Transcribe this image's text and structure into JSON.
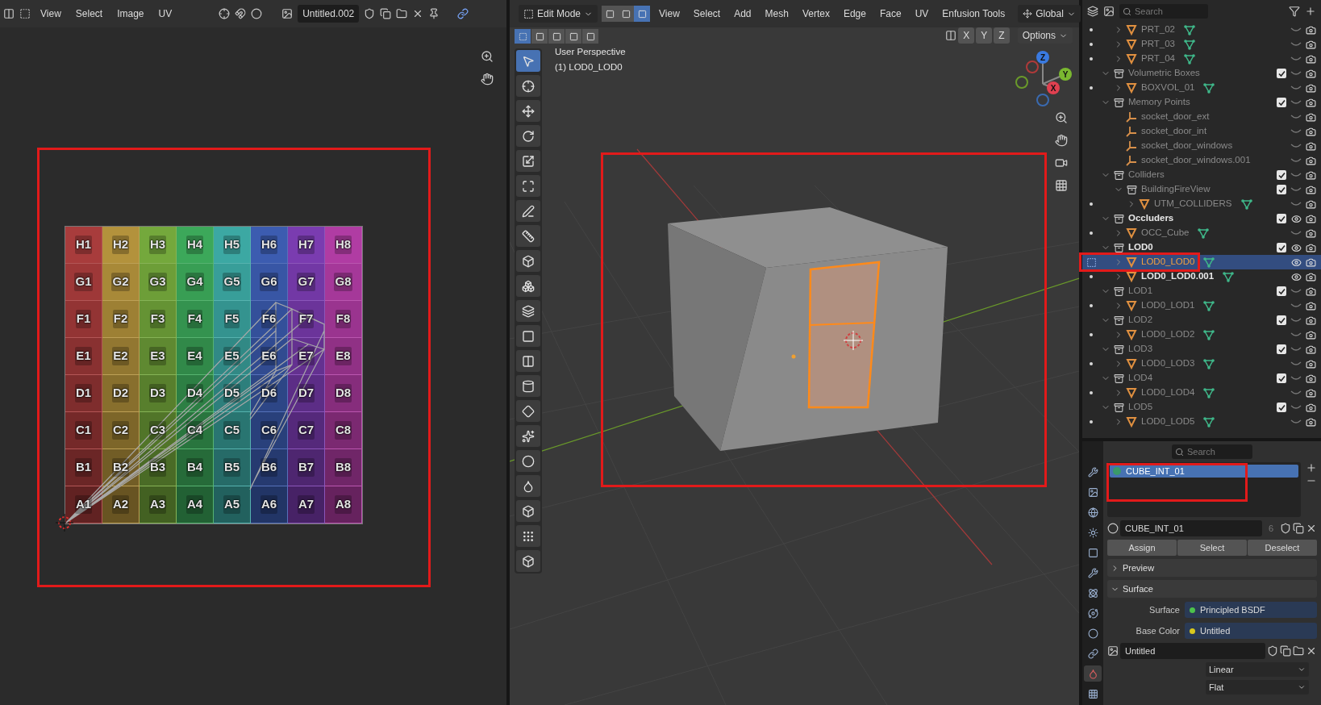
{
  "uv_editor": {
    "menus": [
      "View",
      "Select",
      "Image",
      "UV"
    ],
    "image_name": "Untitled.002",
    "grid": {
      "columns": [
        {
          "color": "#a83c3c"
        },
        {
          "color": "#b3923c"
        },
        {
          "color": "#74a83c"
        },
        {
          "color": "#3ca85a"
        },
        {
          "color": "#3ca8a3"
        },
        {
          "color": "#3c5cb0"
        },
        {
          "color": "#7a3cb0"
        },
        {
          "color": "#b03ca3"
        }
      ],
      "rows": [
        [
          "H1",
          "H2",
          "H3",
          "H4",
          "H5",
          "H6",
          "H7",
          "H8"
        ],
        [
          "G1",
          "G2",
          "G3",
          "G4",
          "G5",
          "G6",
          "G7",
          "G8"
        ],
        [
          "F1",
          "F2",
          "F3",
          "F4",
          "F5",
          "F6",
          "F7",
          "F8"
        ],
        [
          "E1",
          "E2",
          "E3",
          "E4",
          "E5",
          "E6",
          "E7",
          "E8"
        ],
        [
          "D1",
          "D2",
          "D3",
          "D4",
          "D5",
          "D6",
          "D7",
          "D8"
        ],
        [
          "C1",
          "C2",
          "C3",
          "C4",
          "C5",
          "C6",
          "C7",
          "C8"
        ],
        [
          "B1",
          "B2",
          "B3",
          "B4",
          "B5",
          "B6",
          "B7",
          "B8"
        ],
        [
          "A1",
          "A2",
          "A3",
          "A4",
          "A5",
          "A6",
          "A7",
          "A8"
        ]
      ]
    }
  },
  "viewport": {
    "mode": "Edit Mode",
    "menus": [
      "View",
      "Select",
      "Add",
      "Mesh",
      "Vertex",
      "Edge",
      "Face",
      "UV",
      "Enfusion Tools"
    ],
    "orientation": "Global",
    "select_modes": [
      {
        "selected": false
      },
      {
        "selected": false
      },
      {
        "selected": true
      }
    ],
    "axis_toggles": [
      "X",
      "Y",
      "Z"
    ],
    "options": "Options",
    "overlay": [
      "User Perspective",
      "(1) LOD0_LOD0"
    ],
    "gizmo": [
      "Z",
      "Y",
      "X"
    ],
    "tools": [
      {
        "selected": true
      },
      {
        "selected": false
      },
      {
        "selected": false
      },
      {
        "selected": false
      },
      {
        "selected": false
      },
      {
        "selected": false
      },
      {
        "selected": false
      },
      {
        "selected": false
      },
      {
        "selected": false
      },
      {
        "selected": false
      },
      {
        "selected": false
      },
      {
        "selected": false
      },
      {
        "selected": false
      },
      {
        "selected": false
      },
      {
        "selected": false
      },
      {
        "selected": false
      },
      {
        "selected": false
      },
      {
        "selected": false
      },
      {
        "selected": false
      },
      {
        "selected": false
      },
      {
        "selected": false
      }
    ]
  },
  "outliner": {
    "search_placeholder": "Search",
    "items": [
      {
        "kind": "mesh",
        "name": "PRT_02",
        "expanded": false,
        "visible": false,
        "selected": false
      },
      {
        "kind": "mesh",
        "name": "PRT_03",
        "expanded": false,
        "visible": false,
        "selected": false
      },
      {
        "kind": "mesh",
        "name": "PRT_04",
        "expanded": false,
        "visible": false,
        "selected": false
      },
      {
        "kind": "collection",
        "name": "Volumetric Boxes",
        "expanded": true,
        "checked": true,
        "visible": false,
        "selected": false,
        "children": [
          {
            "kind": "mesh",
            "name": "BOXVOL_01",
            "expanded": false,
            "visible": false,
            "selected": false
          }
        ]
      },
      {
        "kind": "collection",
        "name": "Memory Points",
        "expanded": true,
        "checked": true,
        "visible": false,
        "selected": false,
        "children": [
          {
            "kind": "empty",
            "name": "socket_door_ext",
            "visible": false,
            "selected": false
          },
          {
            "kind": "empty",
            "name": "socket_door_int",
            "visible": false,
            "selected": false
          },
          {
            "kind": "empty",
            "name": "socket_door_windows",
            "visible": false,
            "selected": false
          },
          {
            "kind": "empty",
            "name": "socket_door_windows.001",
            "visible": false,
            "selected": false
          }
        ]
      },
      {
        "kind": "collection",
        "name": "Colliders",
        "expanded": true,
        "checked": true,
        "visible": false,
        "selected": false,
        "children": [
          {
            "kind": "collection",
            "name": "BuildingFireView",
            "expanded": true,
            "checked": true,
            "visible": false,
            "selected": false,
            "children": [
              {
                "kind": "mesh",
                "name": "UTM_COLLIDERS",
                "expanded": false,
                "visible": false,
                "selected": false
              }
            ]
          }
        ]
      },
      {
        "kind": "collection",
        "name": "Occluders",
        "expanded": true,
        "checked": true,
        "visible": true,
        "selected": false,
        "children": [
          {
            "kind": "mesh",
            "name": "OCC_Cube",
            "expanded": false,
            "visible": false,
            "selected": false
          }
        ]
      },
      {
        "kind": "collection",
        "name": "LOD0",
        "expanded": true,
        "checked": true,
        "visible": true,
        "selected": false,
        "children": [
          {
            "kind": "mesh",
            "name": "LOD0_LOD0",
            "expanded": false,
            "visible": true,
            "selected": true
          },
          {
            "kind": "mesh",
            "name": "LOD0_LOD0.001",
            "expanded": false,
            "visible": true,
            "selected": false
          }
        ]
      },
      {
        "kind": "collection",
        "name": "LOD1",
        "expanded": true,
        "checked": true,
        "visible": false,
        "selected": false,
        "children": [
          {
            "kind": "mesh",
            "name": "LOD0_LOD1",
            "expanded": false,
            "visible": false,
            "selected": false
          }
        ]
      },
      {
        "kind": "collection",
        "name": "LOD2",
        "expanded": true,
        "checked": true,
        "visible": false,
        "selected": false,
        "children": [
          {
            "kind": "mesh",
            "name": "LOD0_LOD2",
            "expanded": false,
            "visible": false,
            "selected": false
          }
        ]
      },
      {
        "kind": "collection",
        "name": "LOD3",
        "expanded": true,
        "checked": true,
        "visible": false,
        "selected": false,
        "children": [
          {
            "kind": "mesh",
            "name": "LOD0_LOD3",
            "expanded": false,
            "visible": false,
            "selected": false
          }
        ]
      },
      {
        "kind": "collection",
        "name": "LOD4",
        "expanded": true,
        "checked": true,
        "visible": false,
        "selected": false,
        "children": [
          {
            "kind": "mesh",
            "name": "LOD0_LOD4",
            "expanded": false,
            "visible": false,
            "selected": false
          }
        ]
      },
      {
        "kind": "collection",
        "name": "LOD5",
        "expanded": true,
        "checked": true,
        "visible": false,
        "selected": false,
        "children": [
          {
            "kind": "mesh",
            "name": "LOD0_LOD5",
            "expanded": false,
            "visible": false,
            "selected": false
          }
        ]
      }
    ]
  },
  "properties": {
    "search_placeholder": "Search",
    "tabs": [
      {
        "selected": false
      },
      {
        "selected": false
      },
      {
        "selected": false
      },
      {
        "selected": false
      },
      {
        "selected": false
      },
      {
        "selected": false
      },
      {
        "selected": false
      },
      {
        "selected": false
      },
      {
        "selected": false
      },
      {
        "selected": false
      },
      {
        "selected": true
      },
      {
        "selected": false
      }
    ],
    "slots": [
      {
        "name": "CUBE_INT_01",
        "selected": true
      }
    ],
    "material": {
      "name": "CUBE_INT_01",
      "users": "6"
    },
    "buttons": [
      "Assign",
      "Select",
      "Deselect"
    ],
    "panels": [
      {
        "title": "Preview",
        "expanded": false
      },
      {
        "title": "Surface",
        "expanded": true
      }
    ],
    "fields": [
      {
        "label": "Surface",
        "value": "Principled BSDF",
        "color": "#4cc24c"
      },
      {
        "label": "Base Color",
        "value": "Untitled",
        "color": "#d8c81e"
      }
    ],
    "image": "Untitled",
    "dropdowns": [
      "Linear",
      "Flat"
    ]
  }
}
